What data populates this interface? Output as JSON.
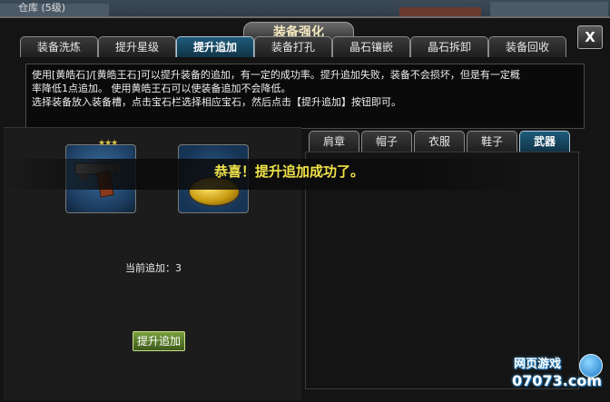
{
  "prev_window_title": "仓库 (5级)",
  "window": {
    "title": "装备强化",
    "close_label": "X"
  },
  "top_tabs": [
    {
      "label": "装备洗炼",
      "active": false
    },
    {
      "label": "提升星级",
      "active": false
    },
    {
      "label": "提升追加",
      "active": true
    },
    {
      "label": "装备打孔",
      "active": false
    },
    {
      "label": "晶石镶嵌",
      "active": false
    },
    {
      "label": "晶石拆卸",
      "active": false
    },
    {
      "label": "装备回收",
      "active": false
    }
  ],
  "description": {
    "line1": "使用[黄皓石]/[黄皓王石]可以提升装备的追加，有一定的成功率。提升追加失败，装备不会损坏，但是有一定概",
    "line2": "率降低1点追加。 使用黄皓王石可以使装备追加不会降低。",
    "line3": "选择装备放入装备槽，点击宝石栏选择相应宝石，然后点击【提升追加】按钮即可。"
  },
  "equip_slot": {
    "star_rating": 3,
    "stars": "★★★"
  },
  "current_label": "当前追加：3",
  "action_button": "提升追加",
  "right_tabs": [
    {
      "label": "肩章",
      "active": false
    },
    {
      "label": "帽子",
      "active": false
    },
    {
      "label": "衣服",
      "active": false
    },
    {
      "label": "鞋子",
      "active": false
    },
    {
      "label": "武器",
      "active": true
    }
  ],
  "banner_message": "恭喜！提升追加成功了。",
  "watermark": {
    "line1": "网页游戏",
    "line2": "07073.com"
  }
}
